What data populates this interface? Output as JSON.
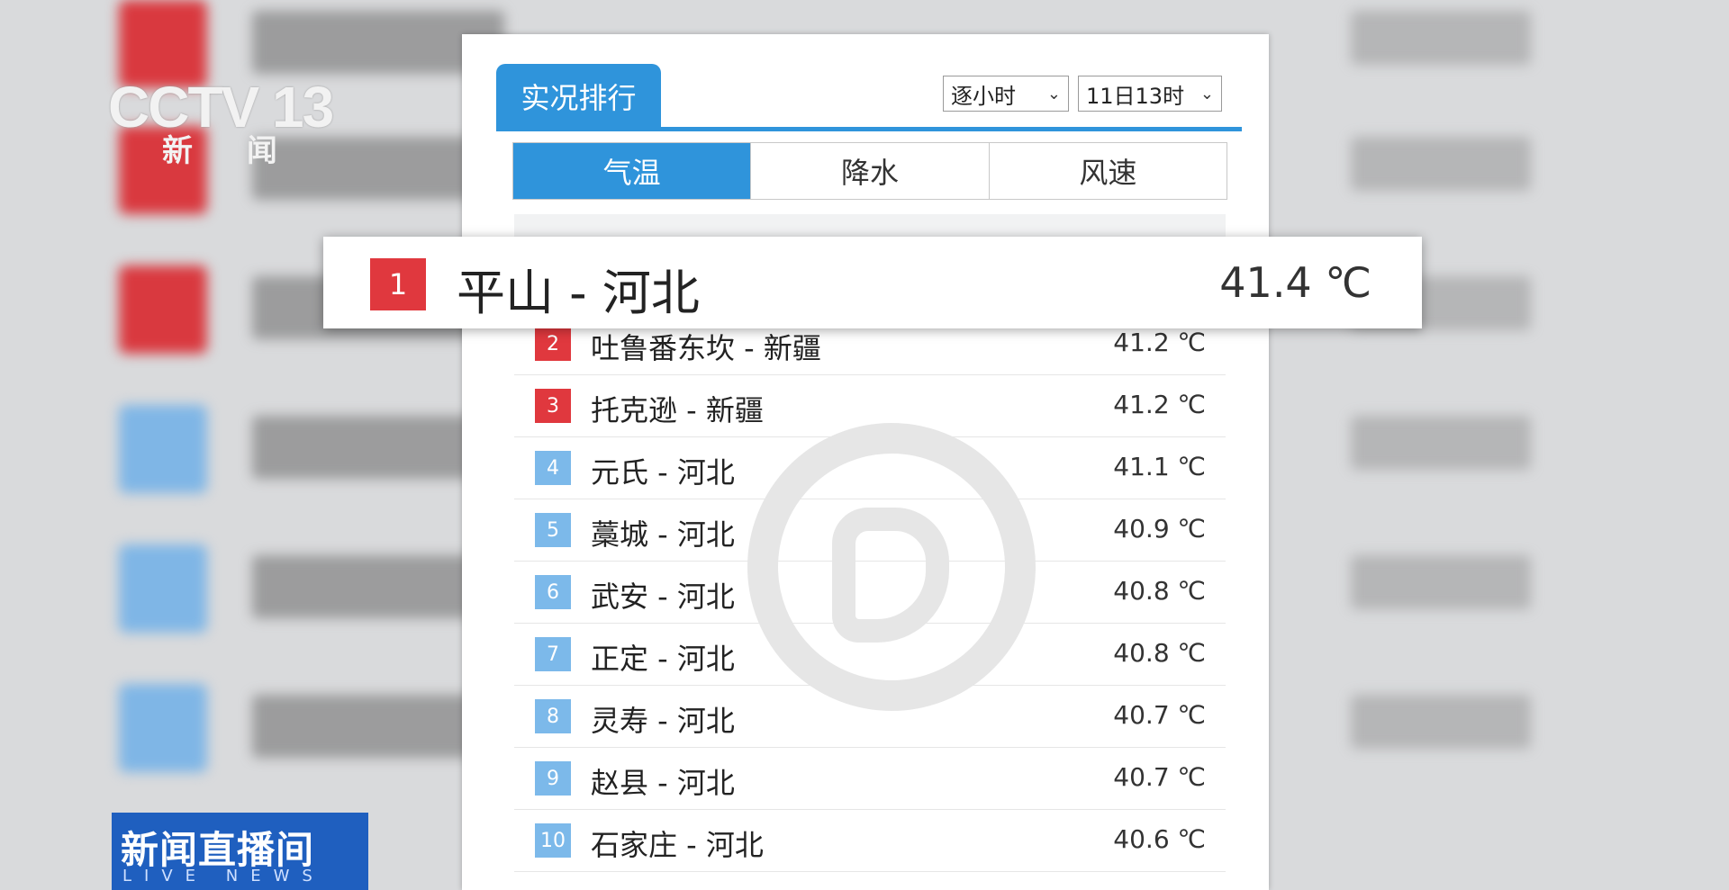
{
  "logo": {
    "channel": "CCTV 13",
    "sub": "新 闻"
  },
  "live_badge": {
    "title": "新闻直播间",
    "sub": "LIVE NEWS"
  },
  "panel": {
    "tab_label": "实况排行",
    "interval_select": "逐小时",
    "time_select": "11日13时",
    "segments": [
      "气温",
      "降水",
      "风速"
    ],
    "active_segment": "气温"
  },
  "highlight": {
    "rank": "1",
    "place": "平山 - 河北",
    "value": "41.4 ℃"
  },
  "rankings": [
    {
      "rank": "2",
      "place": "吐鲁番东坎 - 新疆",
      "value": "41.2 ℃",
      "color": "#e0383e"
    },
    {
      "rank": "3",
      "place": "托克逊 - 新疆",
      "value": "41.2 ℃",
      "color": "#e0383e"
    },
    {
      "rank": "4",
      "place": "元氏 - 河北",
      "value": "41.1 ℃",
      "color": "#7cb9ea"
    },
    {
      "rank": "5",
      "place": "藁城 - 河北",
      "value": "40.9 ℃",
      "color": "#7cb9ea"
    },
    {
      "rank": "6",
      "place": "武安 - 河北",
      "value": "40.8 ℃",
      "color": "#7cb9ea"
    },
    {
      "rank": "7",
      "place": "正定 - 河北",
      "value": "40.8 ℃",
      "color": "#7cb9ea"
    },
    {
      "rank": "8",
      "place": "灵寿 - 河北",
      "value": "40.7 ℃",
      "color": "#7cb9ea"
    },
    {
      "rank": "9",
      "place": "赵县 - 河北",
      "value": "40.7 ℃",
      "color": "#7cb9ea"
    },
    {
      "rank": "10",
      "place": "石家庄 - 河北",
      "value": "40.6 ℃",
      "color": "#7cb9ea"
    }
  ]
}
